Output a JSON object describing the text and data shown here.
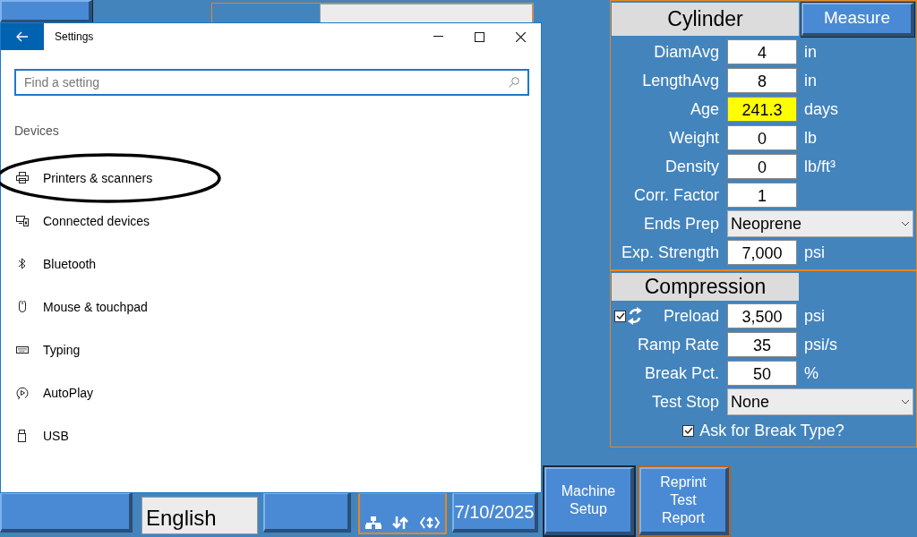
{
  "background_app": {
    "language": {
      "value": "English"
    },
    "date": "7/10/2025"
  },
  "cylinder": {
    "title": "Cylinder",
    "measure_button": "Measure",
    "fields": [
      {
        "kind": "input",
        "label": "DiamAvg",
        "value": "4",
        "unit": "in",
        "highlighted": false
      },
      {
        "kind": "input",
        "label": "LengthAvg",
        "value": "8",
        "unit": "in",
        "highlighted": false
      },
      {
        "kind": "input",
        "label": "Age",
        "value": "241.3",
        "unit": "days",
        "highlighted": true
      },
      {
        "kind": "input",
        "label": "Weight",
        "value": "0",
        "unit": "lb",
        "highlighted": false
      },
      {
        "kind": "input",
        "label": "Density",
        "value": "0",
        "unit": "lb/ft³",
        "highlighted": false
      },
      {
        "kind": "input",
        "label": "Corr. Factor",
        "value": "1",
        "highlighted": false
      },
      {
        "kind": "dropdown",
        "label": "Ends Prep",
        "value": "Neoprene"
      },
      {
        "kind": "input",
        "label": "Exp. Strength",
        "value": "7,000",
        "unit": "psi",
        "highlighted": false
      }
    ]
  },
  "compression": {
    "title": "Compression",
    "fields": [
      {
        "kind": "preload",
        "label": "Preload",
        "value": "3,500",
        "unit": "psi",
        "checked": true
      },
      {
        "kind": "input",
        "label": "Ramp Rate",
        "value": "35",
        "unit": "psi/s",
        "highlighted": false
      },
      {
        "kind": "input",
        "label": "Break Pct.",
        "value": "50",
        "unit": "%",
        "highlighted": false
      },
      {
        "kind": "dropdown",
        "label": "Test Stop",
        "value": "None"
      }
    ],
    "ask_break_type": {
      "label": "Ask for Break Type?",
      "checked": true
    }
  },
  "buttons": [
    {
      "label": "Machine Setup",
      "focused": false
    },
    {
      "label": "Reprint Test Report",
      "focused": true
    }
  ],
  "settings": {
    "title": "Settings",
    "search_placeholder": "Find a setting",
    "section": "Devices",
    "items": [
      {
        "kind": "printer",
        "label": "Printers & scanners",
        "circled": true
      },
      {
        "kind": "devices",
        "label": "Connected devices",
        "circled": false
      },
      {
        "kind": "bluetooth",
        "label": "Bluetooth",
        "circled": false
      },
      {
        "kind": "mouse",
        "label": "Mouse & touchpad",
        "circled": false
      },
      {
        "kind": "keyboard",
        "label": "Typing",
        "circled": false
      },
      {
        "kind": "autoplay",
        "label": "AutoPlay",
        "circled": false
      },
      {
        "kind": "usb",
        "label": "USB",
        "circled": false
      }
    ]
  }
}
